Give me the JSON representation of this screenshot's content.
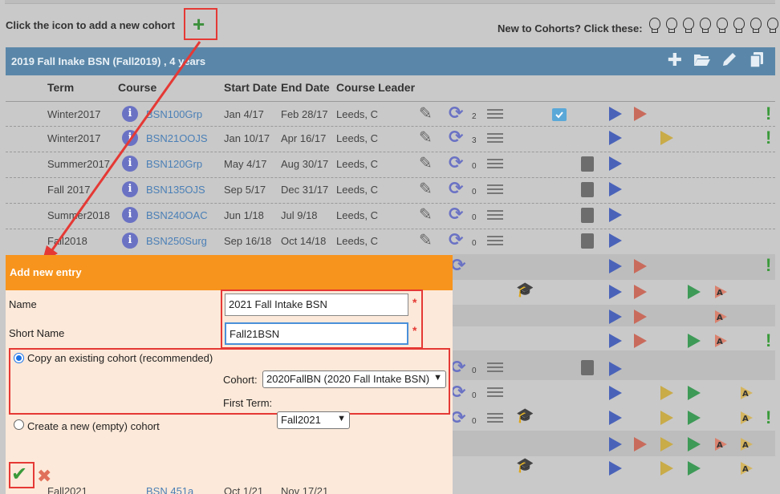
{
  "instruction": "Click the icon to add a new cohort",
  "new_to_cohorts": "New to Cohorts? Click these:",
  "bulb_count": 8,
  "cohort_banner": {
    "title": "2019 Fall Inake BSN (Fall2019) , 4 years",
    "icons": [
      "plus-icon",
      "folder-open-icon",
      "pencil-icon",
      "copy-icon"
    ]
  },
  "table": {
    "headers": {
      "term": "Term",
      "course": "Course",
      "start": "Start Date",
      "end": "End Date",
      "leader": "Course Leader"
    },
    "rows": [
      {
        "term": "Winter2017",
        "course": "BSN100Grp",
        "start": "Jan 4/17",
        "end": "Feb 28/17",
        "leader": "Leeds, C",
        "count": "2"
      },
      {
        "term": "Winter2017",
        "course": "BSN21OOJS",
        "start": "Jan 10/17",
        "end": "Apr 16/17",
        "leader": "Leeds, C",
        "count": "3"
      },
      {
        "term": "Summer2017",
        "course": "BSN120Grp",
        "start": "May 4/17",
        "end": "Aug 30/17",
        "leader": "Leeds, C",
        "count": "0"
      },
      {
        "term": "Fall 2017",
        "course": "BSN135OJS",
        "start": "Sep 5/17",
        "end": "Dec 31/17",
        "leader": "Leeds, C",
        "count": "0"
      },
      {
        "term": "Summer2018",
        "course": "BSN240OAC",
        "start": "Jun 1/18",
        "end": "Jul 9/18",
        "leader": "Leeds, C",
        "count": "0"
      },
      {
        "term": "Fall2018",
        "course": "BSN250Surg",
        "start": "Sep 16/18",
        "end": "Oct 14/18",
        "leader": "Leeds, C",
        "count": "0"
      }
    ],
    "partial_counts": [
      "0",
      "0",
      "0"
    ],
    "bottom_row": {
      "term": "Fall2021",
      "course": "BSN 451a",
      "start": "Oct 1/21",
      "end": "Nov 17/21"
    }
  },
  "dialog": {
    "title": "Add new entry",
    "name_label": "Name",
    "name_value": "2021 Fall Intake BSN",
    "short_name_label": "Short Name",
    "short_name_value": "Fall21BSN",
    "required_mark": "*",
    "copy_option": "Copy an existing cohort (recommended)",
    "cohort_label": "Cohort:",
    "cohort_value": "2020FallBN (2020 Fall Intake BSN)",
    "first_term_label": "First Term:",
    "first_term_value": "Fall2021",
    "new_option": "Create a new (empty) cohort"
  },
  "colors": {
    "accent_orange": "#f7941d",
    "banner_blue": "#5a87a9",
    "highlight_red": "#e53935"
  }
}
